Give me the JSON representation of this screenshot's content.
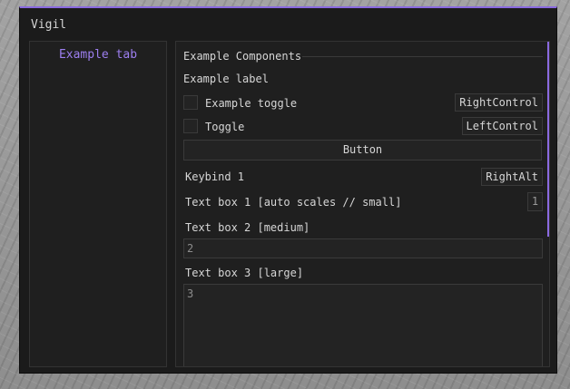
{
  "window": {
    "title": "Vigil",
    "accent_color": "#8a6ae0"
  },
  "sidebar": {
    "tabs": [
      {
        "label": "Example tab",
        "active": true
      }
    ]
  },
  "content": {
    "section_title": "Example Components",
    "label": "Example label",
    "toggles": [
      {
        "label": "Example toggle",
        "checked": false,
        "keybind": "RightControl"
      },
      {
        "label": "Toggle",
        "checked": false,
        "keybind": "LeftControl"
      }
    ],
    "button_label": "Button",
    "keybind": {
      "label": "Keybind 1",
      "value": "RightAlt"
    },
    "textboxes": [
      {
        "label": "Text box 1 [auto scales // small]",
        "value": "1"
      },
      {
        "label": "Text box 2 [medium]",
        "value": "2"
      },
      {
        "label": "Text box 3 [large]",
        "value": "3"
      }
    ]
  }
}
